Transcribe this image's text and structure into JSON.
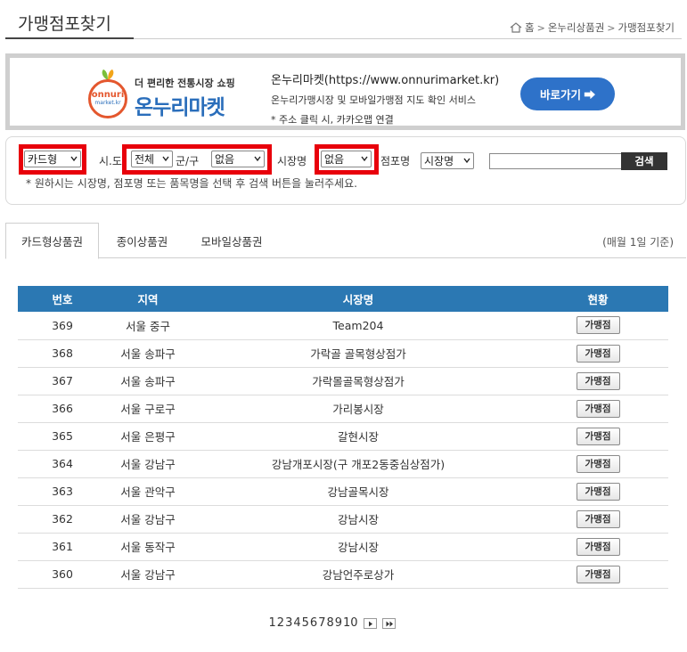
{
  "header": {
    "title": "가맹점포찾기",
    "breadcrumb": [
      "홈",
      "온누리상품권",
      "가맹점포찾기"
    ]
  },
  "banner": {
    "logo_circle_top": "onnuri",
    "logo_circle_bottom": "market.kr",
    "logo_tagline": "더 편리한 전통시장 쇼핑",
    "logo_name": "온누리마켓",
    "line1": "온누리마켓(https://www.onnurimarket.kr)",
    "line2": "온누리가맹시장 및 모바일가맹점 지도 확인 서비스",
    "line3": "* 주소 클릭 시, 카카오맵 연결",
    "button_label": "바로가기 ➡"
  },
  "search": {
    "type_select": "카드형",
    "sido_label": "시.도",
    "sido_select": "전체",
    "gugun_label": "군/구",
    "gugun_select": "없음",
    "market_label": "시장명",
    "market_select": "없음",
    "store_label": "점포명",
    "store_select": "시장명",
    "search_input_value": "",
    "search_button": "검색",
    "note": "* 원하시는 시장명, 점포명 또는 품목명을 선택 후 검색 버튼을 눌러주세요."
  },
  "tabs": {
    "items": [
      "카드형상품권",
      "종이상품권",
      "모바일상품권"
    ],
    "active": 0,
    "note": "(매월 1일 기준)"
  },
  "table": {
    "headers": [
      "번호",
      "지역",
      "시장명",
      "현황"
    ],
    "rows": [
      {
        "no": "369",
        "region": "서울 중구",
        "market": "Team204",
        "status": "가맹점"
      },
      {
        "no": "368",
        "region": "서울 송파구",
        "market": "가락골 골목형상점가",
        "status": "가맹점"
      },
      {
        "no": "367",
        "region": "서울 송파구",
        "market": "가락몰골목형상점가",
        "status": "가맹점"
      },
      {
        "no": "366",
        "region": "서울 구로구",
        "market": "가리봉시장",
        "status": "가맹점"
      },
      {
        "no": "365",
        "region": "서울 은평구",
        "market": "갈현시장",
        "status": "가맹점"
      },
      {
        "no": "364",
        "region": "서울 강남구",
        "market": "강남개포시장(구 개포2동중심상점가)",
        "status": "가맹점"
      },
      {
        "no": "363",
        "region": "서울 관악구",
        "market": "강남골목시장",
        "status": "가맹점"
      },
      {
        "no": "362",
        "region": "서울 강남구",
        "market": "강남시장",
        "status": "가맹점"
      },
      {
        "no": "361",
        "region": "서울 동작구",
        "market": "강남시장",
        "status": "가맹점"
      },
      {
        "no": "360",
        "region": "서울 강남구",
        "market": "강남언주로상가",
        "status": "가맹점"
      }
    ]
  },
  "pagination": {
    "pages": [
      "1",
      "2",
      "3",
      "4",
      "5",
      "6",
      "7",
      "8",
      "9",
      "10"
    ],
    "current": "1"
  },
  "colors": {
    "table_header": "#2b78b3",
    "banner_button": "#2e72c9",
    "highlight_box": "#e8000b"
  }
}
